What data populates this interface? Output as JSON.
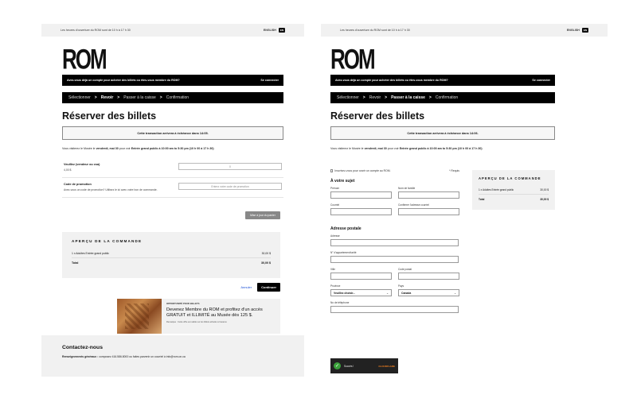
{
  "topbar": {
    "hours": "Les heures d'ouverture du ROM sont de 10 h à 17 h 30",
    "language": "ENGLISH",
    "language_badge": "EN"
  },
  "brand": {
    "logo": "ROM"
  },
  "login_bar": {
    "text": "Avez-vous déjà un compte pour acheter des billets ou êtes-vous membre du ROM?",
    "link": "Se connecter"
  },
  "steps": [
    {
      "label": "Sélectionner"
    },
    {
      "label": "Revoir"
    },
    {
      "label": "Passer à la caisse"
    },
    {
      "label": "Confirmation"
    }
  ],
  "steps_separator": ">",
  "left": {
    "title": "Réserver des billets",
    "timer": "Cette transaction arrivera à échéance dans 14:05.",
    "visit": {
      "prefix": "Vous visiterez le Musée le",
      "date": "vendredi, mai 30",
      "mid": "pour voir",
      "event": "Entrée grand public à 10:00 am to 5:30 pm (10 h 00 à 17 h 30)"
    },
    "donation": {
      "label": "Veuillez (vendeur ou csa)",
      "sub": "4,00 $",
      "value": "0"
    },
    "promo_code": {
      "label": "Code de promotion",
      "sub": "Avez-vous un code de promotion? Utilisez le ici avec votre bon de commande.",
      "placeholder": "Entrez votre code de promotion"
    },
    "update_button": "Mise à jour du panier",
    "summary": {
      "title": "APERÇU DE LA COMMANDE",
      "line_label": "1 x Adultes Entrée grand public",
      "line_value": "30,00 $",
      "total_label": "Total",
      "total_value": "30,00 $"
    },
    "cancel": "Annuler",
    "continue": "Continuer",
    "promo_card": {
      "kicker": "OPPORTUNITÉ POUR BILLETS",
      "headline": "Devenez Membre du ROM et profitez d'un accès GRATUIT et ILLIMITÉ au Musée dès 125 $.",
      "footer": "Remarque : Cette offre est valide sur les billets achetés à l'avance"
    },
    "contact": {
      "title": "Contactez-nous",
      "line_bold": "Renseignements généraux :",
      "line_rest": "composez 416.586.8000 ou faites parvenir un courriel à info@rom.on.ca"
    }
  },
  "right": {
    "title": "Réserver des billets",
    "timer": "Cette transaction arrivera à échéance dans 14:06.",
    "visit": {
      "prefix": "Vous visiterez le Musée le",
      "date": "vendredi, mai 30",
      "mid": "pour voir",
      "event": "Entrée grand public à 10:00 am to 5:30 pm (10 h 00 à 17 h 30)"
    },
    "signup_checkbox": "Inscrivez-vous pour ouvrir un compte au ROM.",
    "required_note": "* Requis",
    "about_heading": "À votre sujet",
    "fields": {
      "first_name": "Prénom",
      "last_name": "Nom de famille",
      "email": "Courriel",
      "confirm_email": "Confirmer l'adresse courriel",
      "address": "Adresse",
      "unit": "N° d'appartement/unité",
      "city": "Ville",
      "postal": "Code postal",
      "province": "Province",
      "country": "Pays",
      "phone": "No de téléphone"
    },
    "province_value": "Veuillez choisir...",
    "country_value": "Canada",
    "postal_heading": "Adresse postale",
    "summary": {
      "title": "APERÇU DE LA COMMANDE",
      "line_label": "1 x Adultes Entrée grand public",
      "line_value": "30,00 $",
      "total_label": "Total",
      "total_value": "30,00 $"
    },
    "captcha": {
      "status": "Succès !",
      "brand": "CLOUDFLARE"
    }
  }
}
